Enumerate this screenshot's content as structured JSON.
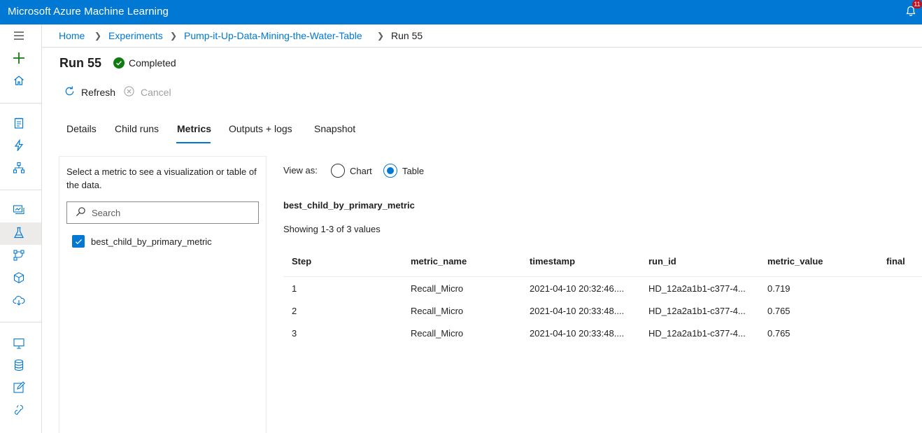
{
  "app": {
    "title": "Microsoft Azure Machine Learning",
    "notification_count": "11"
  },
  "breadcrumb": [
    {
      "label": "Home"
    },
    {
      "label": "Experiments"
    },
    {
      "label": "Pump-it-Up-Data-Mining-the-Water-Table"
    },
    {
      "label": "Run 55"
    }
  ],
  "run": {
    "title": "Run 55",
    "status": "Completed"
  },
  "commands": {
    "refresh": "Refresh",
    "cancel": "Cancel"
  },
  "tabs": [
    {
      "label": "Details"
    },
    {
      "label": "Child runs"
    },
    {
      "label": "Metrics"
    },
    {
      "label": "Outputs + logs"
    },
    {
      "label": "Snapshot"
    }
  ],
  "metrics_panel": {
    "description": "Select a metric to see a visualization or table of the data.",
    "search_placeholder": "Search",
    "items": [
      {
        "label": "best_child_by_primary_metric",
        "checked": true
      }
    ]
  },
  "view": {
    "label": "View as:",
    "options": [
      "Chart",
      "Table"
    ],
    "selected": "Table"
  },
  "metric": {
    "name": "best_child_by_primary_metric",
    "showing": "Showing 1-3 of 3 values",
    "columns": [
      "Step",
      "metric_name",
      "timestamp",
      "run_id",
      "metric_value",
      "final"
    ],
    "rows": [
      [
        "1",
        "Recall_Micro",
        "2021-04-10 20:32:46....",
        "HD_12a2a1b1-c377-4...",
        "0.719",
        ""
      ],
      [
        "2",
        "Recall_Micro",
        "2021-04-10 20:33:48....",
        "HD_12a2a1b1-c377-4...",
        "0.765",
        ""
      ],
      [
        "3",
        "Recall_Micro",
        "2021-04-10 20:33:48....",
        "HD_12a2a1b1-c377-4...",
        "0.765",
        ""
      ]
    ]
  },
  "colors": {
    "accent": "#0078d4",
    "success": "#107c10",
    "sidebar_add": "#107c10",
    "badge": "#c50f1f"
  }
}
